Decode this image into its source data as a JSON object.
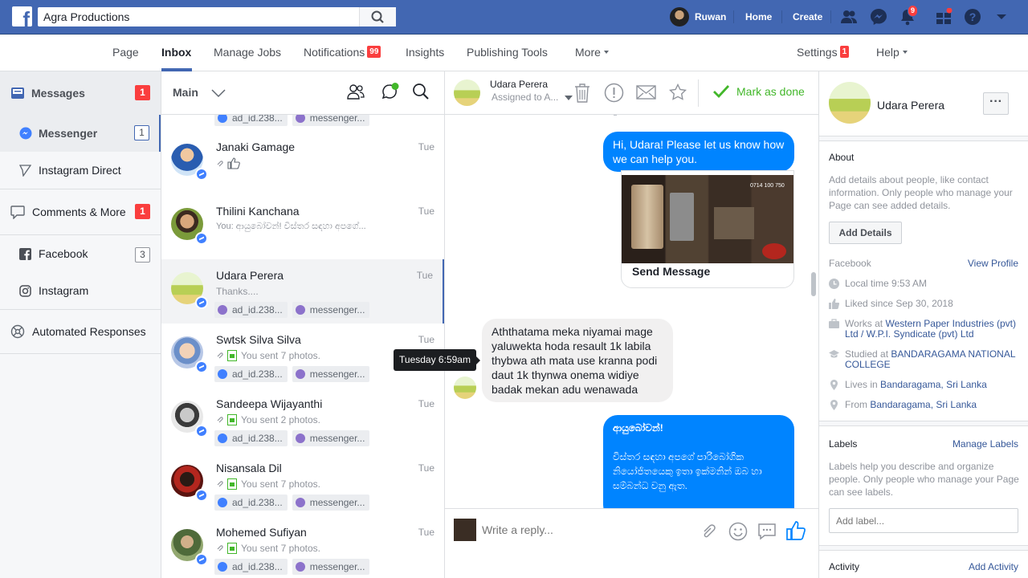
{
  "topbar": {
    "search_value": "Agra Productions",
    "user_name": "Ruwan",
    "home_label": "Home",
    "create_label": "Create",
    "notifications_count": "9"
  },
  "pagenav": {
    "items": [
      "Page",
      "Inbox",
      "Manage Jobs",
      "Notifications",
      "Insights",
      "Publishing Tools",
      "More",
      "Settings",
      "Help"
    ],
    "notifications_badge": "99",
    "settings_badge": "1"
  },
  "sidebar": {
    "messages_label": "Messages",
    "messages_count": "1",
    "messenger_label": "Messenger",
    "messenger_count": "1",
    "instagram_direct_label": "Instagram Direct",
    "comments_label": "Comments & More",
    "comments_count": "1",
    "facebook_label": "Facebook",
    "facebook_count": "3",
    "instagram_label": "Instagram",
    "automated_label": "Automated Responses"
  },
  "conversations": {
    "filter_label": "Main",
    "top_tags": [
      "ad_id.238...",
      "messenger..."
    ],
    "items": [
      {
        "name": "Janaki Gamage",
        "time": "Tue",
        "snippet": "",
        "tags": []
      },
      {
        "name": "Thilini Kanchana",
        "time": "Tue",
        "snippet": "You: ආයුබෝවන්! විස්තර සඳහා අපගේ...",
        "tags": []
      },
      {
        "name": "Udara Perera",
        "time": "Tue",
        "snippet": "Thanks....",
        "tags": [
          "ad_id.238...",
          "messenger..."
        ]
      },
      {
        "name": "Swtsk Silva Silva",
        "time": "Tue",
        "snippet": "You sent 7 photos.",
        "tags": [
          "ad_id.238...",
          "messenger..."
        ]
      },
      {
        "name": "Sandeepa Wijayanthi",
        "time": "Tue",
        "snippet": "You sent 2 photos.",
        "tags": [
          "ad_id.238...",
          "messenger..."
        ]
      },
      {
        "name": "Nisansala Dil",
        "time": "Tue",
        "snippet": "You sent 7 photos.",
        "tags": [
          "ad_id.238...",
          "messenger..."
        ]
      },
      {
        "name": "Mohemed Sufiyan",
        "time": "Tue",
        "snippet": "You sent 7 photos.",
        "tags": [
          "ad_id.238...",
          "messenger..."
        ]
      }
    ]
  },
  "chat": {
    "contact_name": "Udara Perera",
    "assigned_label": "Assigned to A...",
    "mark_done_label": "Mark as done",
    "msg1": "Hi, Udara! Please let us know how we can help you.",
    "send_message_label": "Send Message",
    "img_phone": "0714 100 750",
    "msg2": "Aththatama meka niyamai mage yaluwekta hoda resault 1k labila thybwa ath mata use kranna podi daut 1k thynwa onema widiye badak mekan adu wenawada",
    "tooltip": "Tuesday 6:59am",
    "msg3_line1": "ආයුබෝවන්!",
    "msg3_line2": "විස්තර සඳහා අපගේ පාරිබෝගික නියෝජිතයෙකු ඉතා ඉක්මනින් ඔබ හා සම්බන්ධ වනු ඇත.",
    "reply_placeholder": "Write a reply..."
  },
  "right": {
    "name": "Udara Perera",
    "about_title": "About",
    "about_text": "Add details about people, like contact information. Only people who manage your Page can see added details.",
    "add_details_label": "Add Details",
    "facebook_label": "Facebook",
    "view_profile_label": "View Profile",
    "local_time": "Local time 9:53 AM",
    "liked_since": "Liked since Sep 30, 2018",
    "works_prefix": "Works at ",
    "works_link": "Western Paper Industries (pvt) Ltd / W.P.I. Syndicate (pvt) Ltd",
    "studied_prefix": "Studied at ",
    "studied_link": "BANDARAGAMA NATIONAL COLLEGE",
    "lives_prefix": "Lives in ",
    "lives_link": "Bandaragama, Sri Lanka",
    "from_prefix": "From ",
    "from_link": "Bandaragama, Sri Lanka",
    "labels_title": "Labels",
    "manage_labels": "Manage Labels",
    "labels_text": "Labels help you describe and organize people. Only people who manage your Page can see labels.",
    "add_label_placeholder": "Add label...",
    "activity_title": "Activity",
    "add_activity": "Add Activity"
  }
}
